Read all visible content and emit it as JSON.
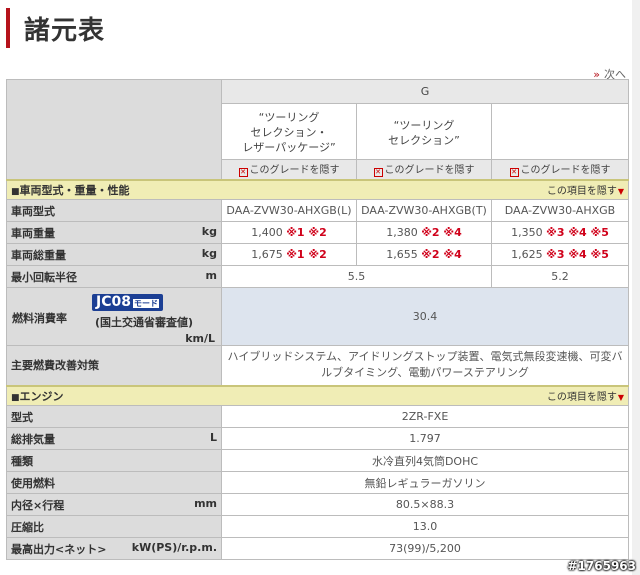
{
  "page": {
    "title": "諸元表",
    "next_link": "次へ",
    "next_chevron": "»"
  },
  "table": {
    "grade": "G",
    "variants": [
      "“ツーリング\nセレクション・\nレザーパッケージ”",
      "“ツーリング\nセレクション”",
      ""
    ],
    "hide_grade_label": "このグレードを隠す",
    "sections": [
      {
        "title": "車両型式・重量・性能",
        "hide_label": "この項目を隠す",
        "rows": [
          {
            "label": "車両型式",
            "unit": "",
            "values": [
              {
                "text": "DAA-ZVW30-AHXGB(L)",
                "notes": ""
              },
              {
                "text": "DAA-ZVW30-AHXGB(T)",
                "notes": ""
              },
              {
                "text": "DAA-ZVW30-AHXGB",
                "notes": ""
              }
            ]
          },
          {
            "label": "車両重量",
            "unit": "kg",
            "values": [
              {
                "text": "1,400",
                "notes": "※1 ※2"
              },
              {
                "text": "1,380",
                "notes": "※2 ※4"
              },
              {
                "text": "1,350",
                "notes": "※3 ※4 ※5"
              }
            ]
          },
          {
            "label": "車両総重量",
            "unit": "kg",
            "values": [
              {
                "text": "1,675",
                "notes": "※1 ※2"
              },
              {
                "text": "1,655",
                "notes": "※2 ※4"
              },
              {
                "text": "1,625",
                "notes": "※3 ※4 ※5"
              }
            ]
          },
          {
            "label": "最小回転半径",
            "unit": "m",
            "merged": [
              "5.5",
              "5.2"
            ]
          }
        ],
        "fuel": {
          "label": "燃料消費率",
          "badge": "JC08",
          "badge_mode": "モード",
          "sub": "(国土交通省審査値)",
          "unit": "km/L",
          "value": "30.4"
        },
        "measures": {
          "label": "主要燃費改善対策",
          "value": "ハイブリッドシステム、アイドリングストップ装置、電気式無段変速機、可変バルブタイミング、電動パワーステアリング"
        }
      },
      {
        "title": "エンジン",
        "hide_label": "この項目を隠す",
        "rows": [
          {
            "label": "型式",
            "unit": "",
            "value": "2ZR-FXE"
          },
          {
            "label": "総排気量",
            "unit": "L",
            "value": "1.797"
          },
          {
            "label": "種類",
            "unit": "",
            "value": "水冷直列4気筒DOHC"
          },
          {
            "label": "使用燃料",
            "unit": "",
            "value": "無鉛レギュラーガソリン"
          },
          {
            "label": "内径×行程",
            "unit": "mm",
            "value": "80.5×88.3"
          },
          {
            "label": "圧縮比",
            "unit": "",
            "value": "13.0"
          },
          {
            "label": "最高出力<ネット>",
            "unit": "kW(PS)/r.p.m.",
            "value": "73(99)/5,200"
          }
        ]
      }
    ]
  },
  "watermark": "#1765963",
  "colors": {
    "accent": "#b5121b",
    "section_bg": "#f0edb5",
    "label_bg": "#dcdcdc",
    "fuel_bg": "#dde4ee",
    "note_red": "#d0021b",
    "jc08_blue": "#1c3f94"
  }
}
